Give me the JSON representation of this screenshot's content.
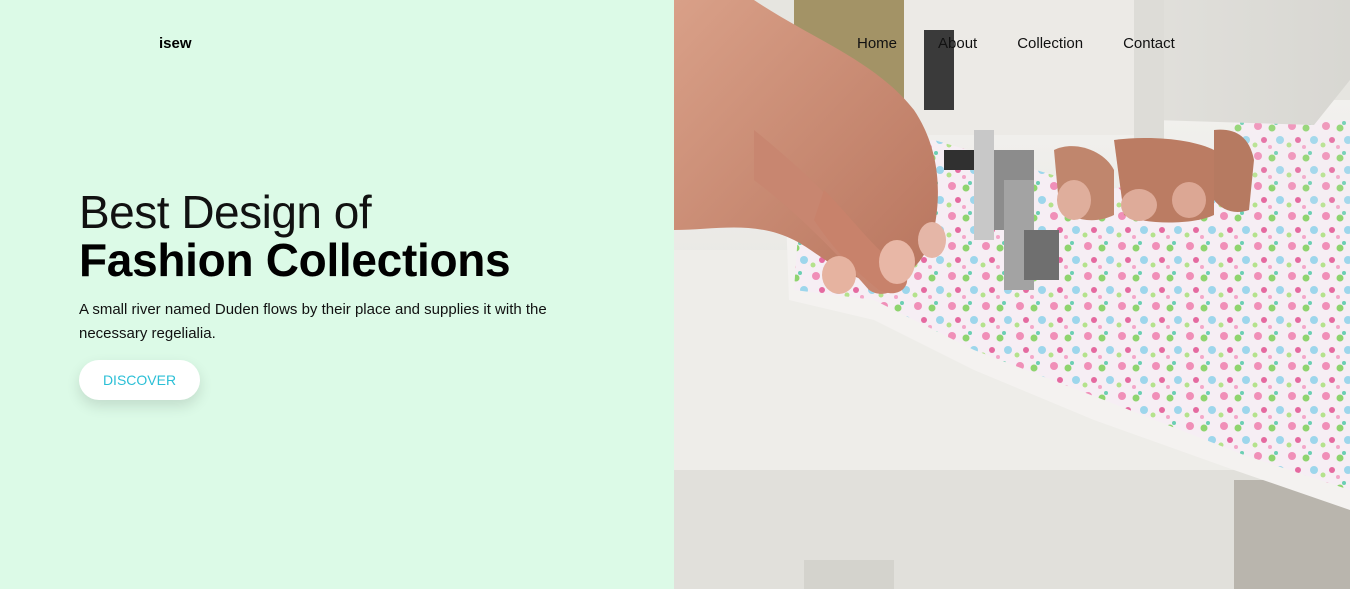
{
  "brand": {
    "logo_text": "isew"
  },
  "nav": {
    "items": [
      {
        "label": "Home"
      },
      {
        "label": "About"
      },
      {
        "label": "Collection"
      },
      {
        "label": "Contact"
      }
    ]
  },
  "hero": {
    "title_line1": "Best Design of",
    "title_line2": "Fashion Collections",
    "description": "A small river named Duden flows by their place and supplies it with the necessary regelialia.",
    "cta_label": "DISCOVER"
  },
  "colors": {
    "page_bg": "#dcfae7",
    "cta_text": "#2bbfd6",
    "cta_bg": "#ffffff"
  }
}
